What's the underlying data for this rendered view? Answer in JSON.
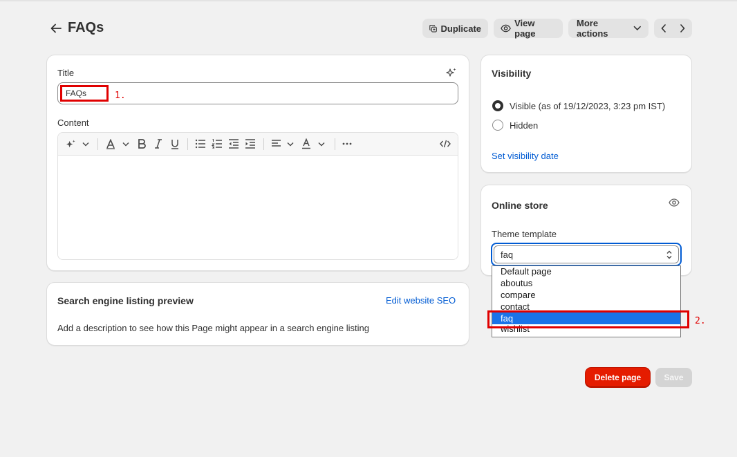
{
  "header": {
    "title": "FAQs",
    "duplicate_label": "Duplicate",
    "view_page_label": "View page",
    "more_actions_label": "More actions"
  },
  "main_card": {
    "title_label": "Title",
    "title_value": "FAQs",
    "content_label": "Content"
  },
  "seo": {
    "heading": "Search engine listing preview",
    "edit_link": "Edit website SEO",
    "description": "Add a description to see how this Page might appear in a search engine listing"
  },
  "visibility": {
    "heading": "Visibility",
    "visible_label": "Visible (as of 19/12/2023, 3:23 pm IST)",
    "hidden_label": "Hidden",
    "selected": "visible",
    "set_date_link": "Set visibility date"
  },
  "online_store": {
    "heading": "Online store",
    "theme_template_label": "Theme template",
    "selected_value": "faq",
    "options": [
      "Default page",
      "aboutus",
      "compare",
      "contact",
      "faq",
      "wishlist"
    ]
  },
  "annotations": {
    "first": "1.",
    "second": "2."
  },
  "footer": {
    "delete_label": "Delete page",
    "save_label": "Save"
  },
  "colors": {
    "accent": "#005bd3",
    "danger": "#e51c00",
    "annotation": "#e00000",
    "dropdown_highlight": "#1a73e8"
  }
}
